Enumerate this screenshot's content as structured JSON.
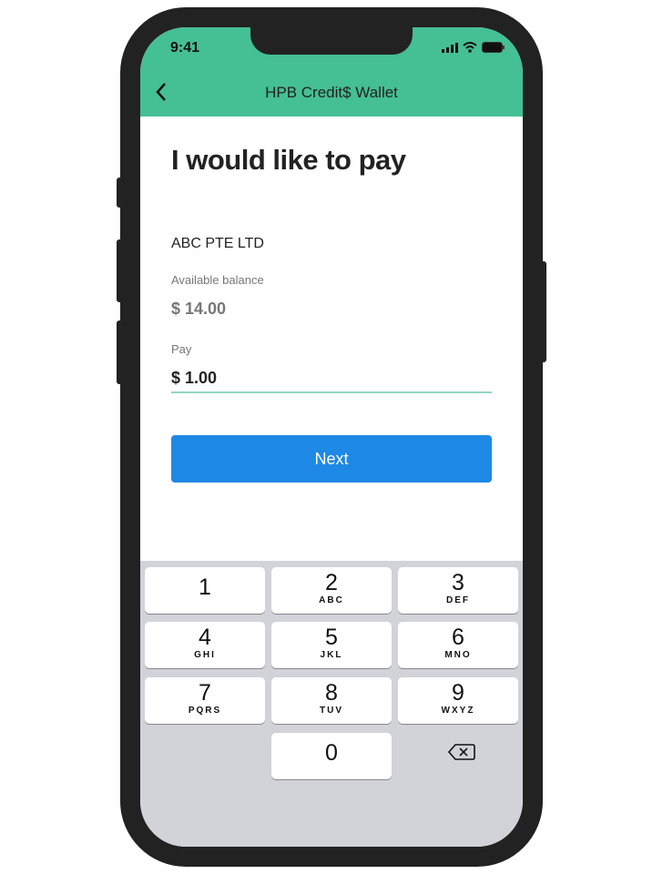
{
  "status_bar": {
    "time": "9:41"
  },
  "header": {
    "title": "HPB Credit$ Wallet",
    "back_icon": "chevron-left-icon"
  },
  "page": {
    "heading": "I would like to pay",
    "merchant": "ABC PTE LTD",
    "balance_label": "Available balance",
    "balance": "$ 14.00",
    "pay_label": "Pay",
    "pay_value": "$ 1.00",
    "next_label": "Next"
  },
  "colors": {
    "header": "#45BF94",
    "button": "#1E88E5",
    "keyboard": "#D1D3D9"
  },
  "keypad": [
    {
      "digit": "1",
      "letters": ""
    },
    {
      "digit": "2",
      "letters": "ABC"
    },
    {
      "digit": "3",
      "letters": "DEF"
    },
    {
      "digit": "4",
      "letters": "GHI"
    },
    {
      "digit": "5",
      "letters": "JKL"
    },
    {
      "digit": "6",
      "letters": "MNO"
    },
    {
      "digit": "7",
      "letters": "PQRS"
    },
    {
      "digit": "8",
      "letters": "TUV"
    },
    {
      "digit": "9",
      "letters": "WXYZ"
    },
    {
      "digit": "0",
      "letters": ""
    }
  ]
}
